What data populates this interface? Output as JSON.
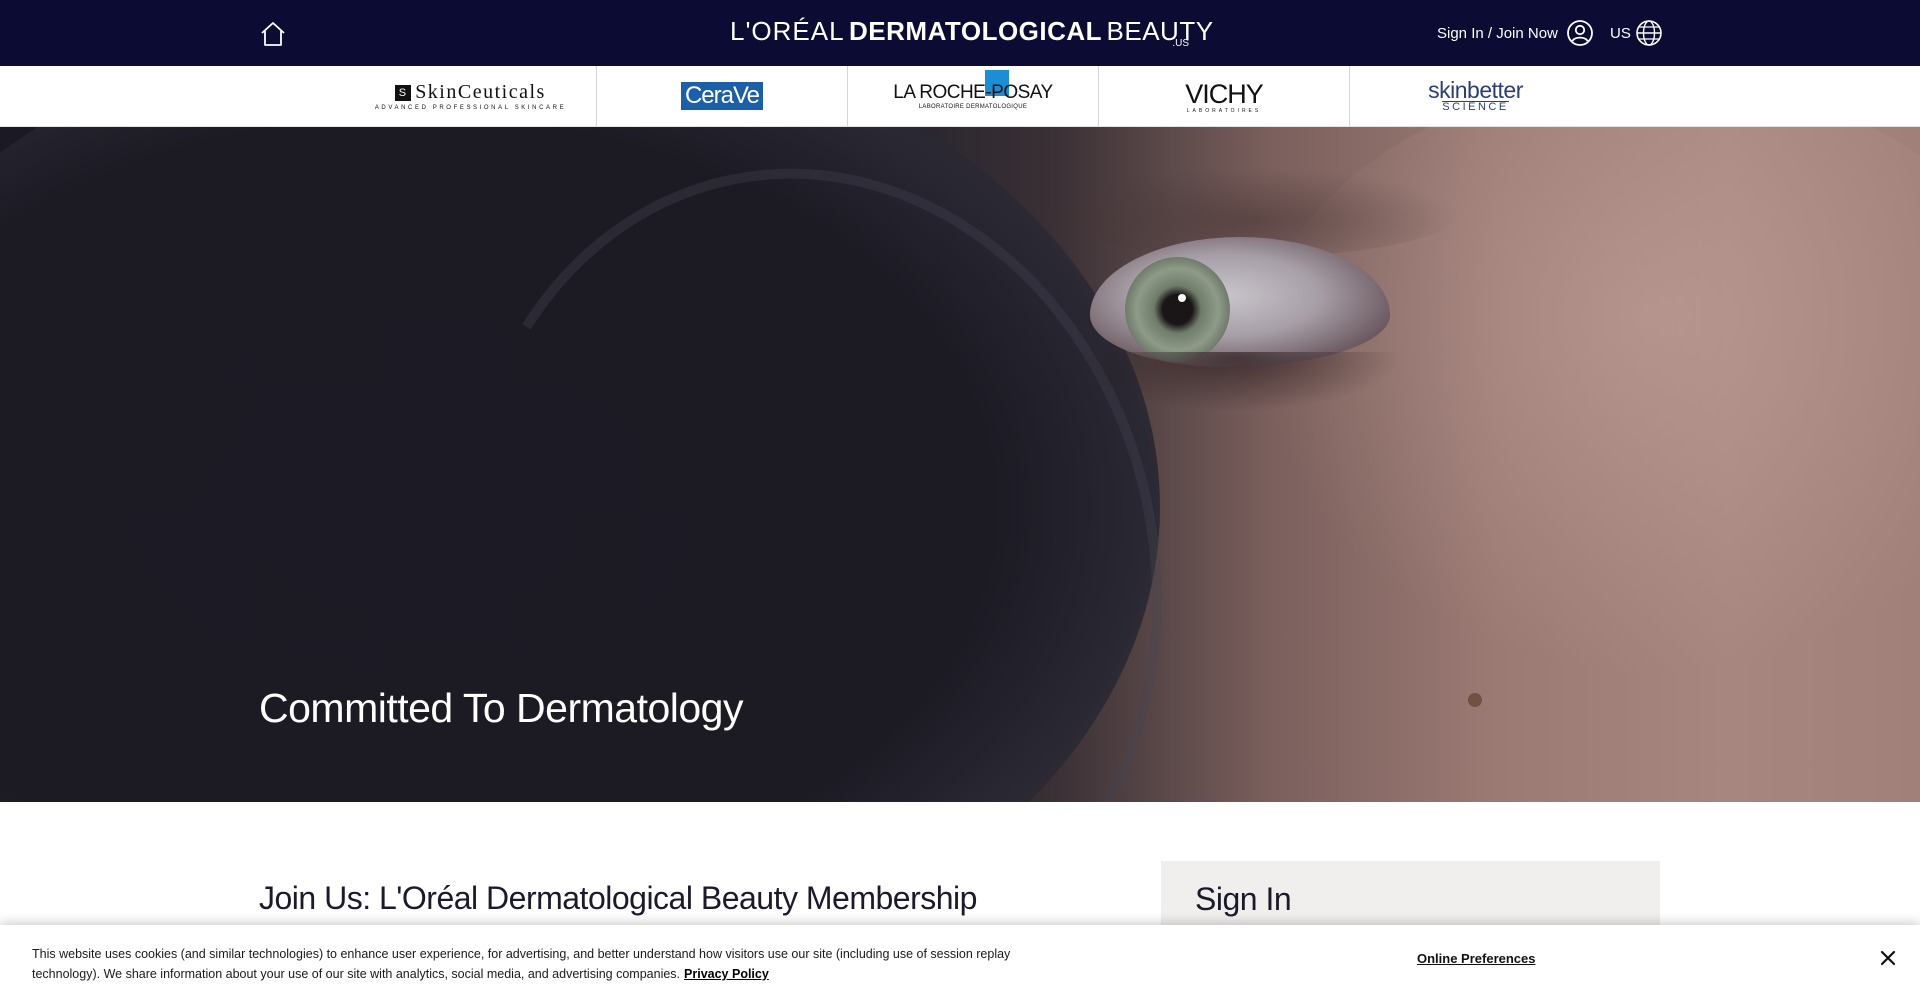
{
  "header": {
    "brand": {
      "part1": "L'ORÉAL",
      "part2": "DERMATOLOGICAL",
      "part3": "BEAUTY",
      "suffix": ".US"
    },
    "signin_label": "Sign In / Join Now",
    "region_label": "US",
    "icons": {
      "home": "home-icon",
      "account": "user-circle-icon",
      "region": "globe-icon"
    },
    "colors": {
      "background": "#0b0b33",
      "text": "#ffffff"
    }
  },
  "brand_strip": {
    "brands": [
      {
        "name": "SkinCeuticals",
        "tagline": "ADVANCED PROFESSIONAL SKINCARE"
      },
      {
        "name": "CeraVe"
      },
      {
        "name": "LA ROCHE-POSAY",
        "tagline": "LABORATOIRE DERMATOLOGIQUE"
      },
      {
        "name": "VICHY",
        "tagline": "LABORATOIRES"
      },
      {
        "name": "skinbetter",
        "tagline": "SCIENCE"
      }
    ]
  },
  "hero": {
    "title": "Committed To Dermatology"
  },
  "main": {
    "join_title": "Join Us: L'Oréal Dermatological Beauty Membership",
    "signin_panel_title": "Sign In"
  },
  "cookie_banner": {
    "text": "This website uses cookies (and similar technologies) to enhance user experience, for advertising, and better understand how visitors use our site (including use of session replay technology). We share information about your use of our site with analytics, social media, and advertising companies.",
    "privacy_link": "Privacy Policy",
    "preferences_link": "Online Preferences",
    "close_icon": "close-icon"
  }
}
